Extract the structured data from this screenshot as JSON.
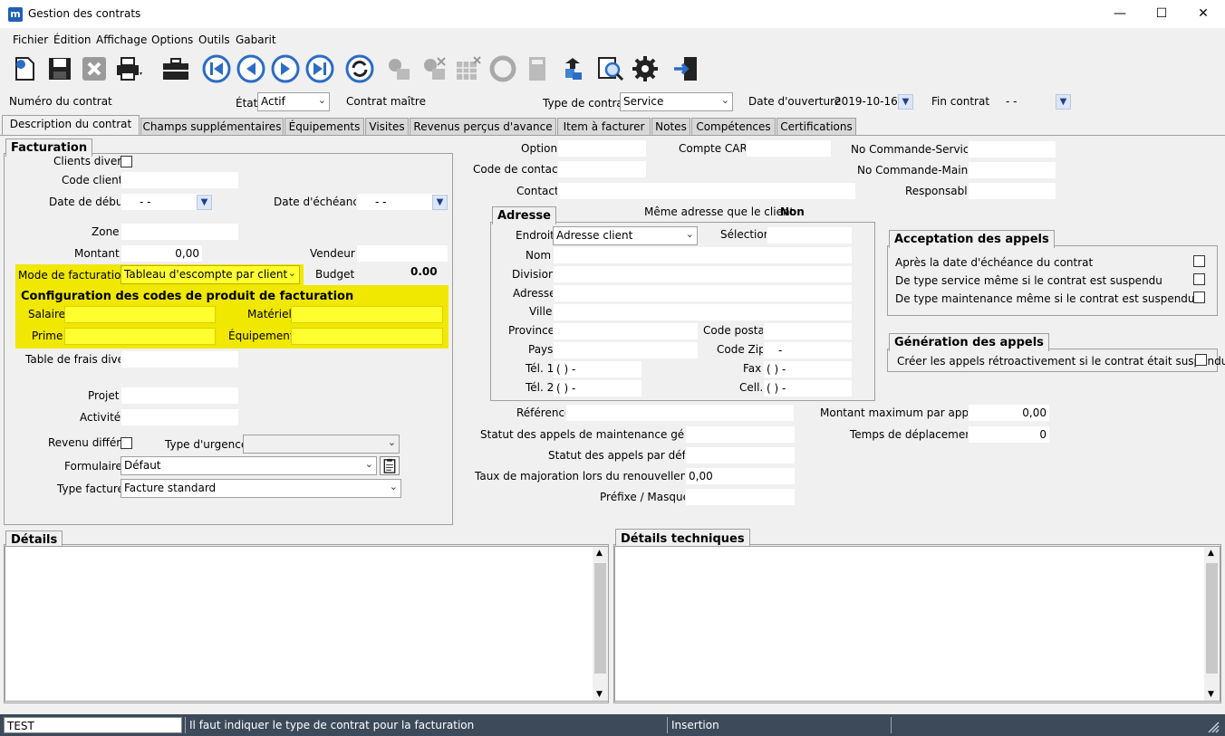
{
  "window": {
    "title": "Gestion des contrats",
    "app_icon": "m",
    "minimize": "—",
    "maximize": "☐",
    "close": "✕"
  },
  "menu": [
    "Fichier",
    "Édition",
    "Affichage",
    "Options",
    "Outils",
    "Gabarit"
  ],
  "header": {
    "numero_label": "Numéro du contrat",
    "etat_label": "État",
    "etat_value": "Actif",
    "maitre_label": "Contrat maître",
    "type_label": "Type de contrat",
    "type_value": "Service",
    "ouverture_label": "Date d'ouverture",
    "ouverture_value": "2019-10-16",
    "fin_label": "Fin contrat",
    "fin_value": "-  -"
  },
  "tabs": [
    "Description du contrat",
    "Champs supplémentaires",
    "Équipements",
    "Visites",
    "Revenus perçus d'avance",
    "Item à facturer",
    "Notes",
    "Compétences",
    "Certifications"
  ],
  "facturation": {
    "title": "Facturation",
    "clients_divers": "Clients divers",
    "code_client": "Code client",
    "date_debut": "Date de début",
    "date_debut_value": "-  -",
    "date_echeance": "Date d'échéance",
    "date_echeance_value": "-  -",
    "zone": "Zone",
    "montant": "Montant",
    "montant_value": "0,00",
    "vendeur": "Vendeur",
    "mode": "Mode de facturation",
    "mode_value": "Tableau d'escompte par client",
    "budget": "Budget",
    "budget_value": "0.00",
    "config_title": "Configuration des codes de produit de facturation",
    "salaire": "Salaire",
    "materiel": "Matériel",
    "prime": "Prime",
    "equipement": "Équipement",
    "table_frais": "Table de frais divers",
    "projet": "Projet",
    "activite": "Activité",
    "revenu_differe": "Revenu différé",
    "type_urgence": "Type d'urgence",
    "formulaire": "Formulaire",
    "formulaire_value": "Défaut",
    "type_facture": "Type facture",
    "type_facture_value": "Facture standard"
  },
  "middle": {
    "option": "Option",
    "compte_car": "Compte CAR",
    "no_cmd_service": "No Commande-Service",
    "code_contact": "Code de contact",
    "no_cmd_maint": "No Commande-Maint.",
    "contact": "Contact",
    "responsable": "Responsable",
    "meme_adresse": "Même adresse que le client",
    "meme_adresse_value": "Non"
  },
  "adresse": {
    "title": "Adresse",
    "endroit": "Endroit",
    "endroit_value": "Adresse client",
    "selection": "Sélection",
    "nom": "Nom",
    "division": "Division",
    "adresse": "Adresse",
    "ville": "Ville",
    "province": "Province",
    "code_postal": "Code postal",
    "pays": "Pays",
    "code_zip": "Code Zip",
    "code_zip_value": "-",
    "tel1": "Tél. 1",
    "tel1_value": "(  )  -",
    "fax": "Fax",
    "fax_value": "(  )  -",
    "tel2": "Tél. 2",
    "tel2_value": "(  )  -",
    "cell": "Cell.",
    "cell_value": "(  )  -"
  },
  "lower": {
    "reference": "Référence",
    "statut_maint": "Statut des appels de maintenance générés",
    "statut_defaut": "Statut des appels par défaut",
    "taux": "Taux de majoration lors du renouvellement",
    "taux_value": "0,00",
    "prefixe": "Préfixe / Masque",
    "montant_max": "Montant maximum par appel",
    "montant_max_value": "0,00",
    "temps": "Temps de déplacement",
    "temps_value": "0"
  },
  "acceptation": {
    "title": "Acceptation des appels",
    "items": [
      "Après la date d'échéance du contrat",
      "De type service même si le contrat est suspendu",
      "De type maintenance même si le contrat est suspendu"
    ]
  },
  "generation": {
    "title": "Génération des appels",
    "item": "Créer les appels rétroactivement si le contrat était suspendu"
  },
  "details": {
    "title": "Détails"
  },
  "details_tech": {
    "title": "Détails techniques"
  },
  "status": {
    "field": "TEST",
    "message": "Il faut indiquer le type de contrat pour la facturation",
    "mode": "Insertion"
  }
}
